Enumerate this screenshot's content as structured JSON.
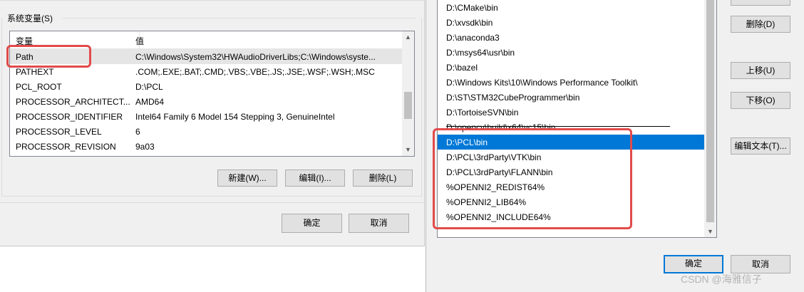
{
  "left_dialog": {
    "group_label": "系统变量(S)",
    "columns": {
      "name": "变量",
      "value": "值"
    },
    "variables": [
      {
        "name": "Path",
        "value": "C:\\Windows\\System32\\HWAudioDriverLibs;C:\\Windows\\syste..."
      },
      {
        "name": "PATHEXT",
        "value": ".COM;.EXE;.BAT;.CMD;.VBS;.VBE;.JS;.JSE;.WSF;.WSH;.MSC"
      },
      {
        "name": "PCL_ROOT",
        "value": "D:\\PCL"
      },
      {
        "name": "PROCESSOR_ARCHITECT...",
        "value": "AMD64"
      },
      {
        "name": "PROCESSOR_IDENTIFIER",
        "value": "Intel64 Family 6 Model 154 Stepping 3, GenuineIntel"
      },
      {
        "name": "PROCESSOR_LEVEL",
        "value": "6"
      },
      {
        "name": "PROCESSOR_REVISION",
        "value": "9a03"
      }
    ],
    "buttons": {
      "new": "新建(W)...",
      "edit": "编辑(I)...",
      "delete": "删除(L)"
    },
    "ok": "确定",
    "cancel": "取消"
  },
  "right_dialog": {
    "paths": [
      "D:\\CMake\\bin",
      "D:\\xvsdk\\bin",
      "D:\\anaconda3",
      "D:\\msys64\\usr\\bin",
      "D:\\bazel",
      "D:\\Windows Kits\\10\\Windows Performance Toolkit\\",
      "D:\\ST\\STM32CubeProgrammer\\bin",
      "D:\\TortoiseSVN\\bin",
      "D:\\opencv\\build\\x64\\vc15\\bin",
      "D:\\PCL\\bin",
      "D:\\PCL\\3rdParty\\VTK\\bin",
      "D:\\PCL\\3rdParty\\FLANN\\bin",
      "%OPENNI2_REDIST64%",
      "%OPENNI2_LIB64%",
      "%OPENNI2_INCLUDE64%"
    ],
    "buttons": {
      "delete": "删除(D)",
      "move_up": "上移(U)",
      "move_down": "下移(O)",
      "edit_text": "编辑文本(T)..."
    },
    "ok": "确定",
    "cancel": "取消"
  },
  "watermark": "CSDN @海雅信子",
  "colors": {
    "selection": "#0078d7",
    "highlight_box": "#e24a4a"
  }
}
